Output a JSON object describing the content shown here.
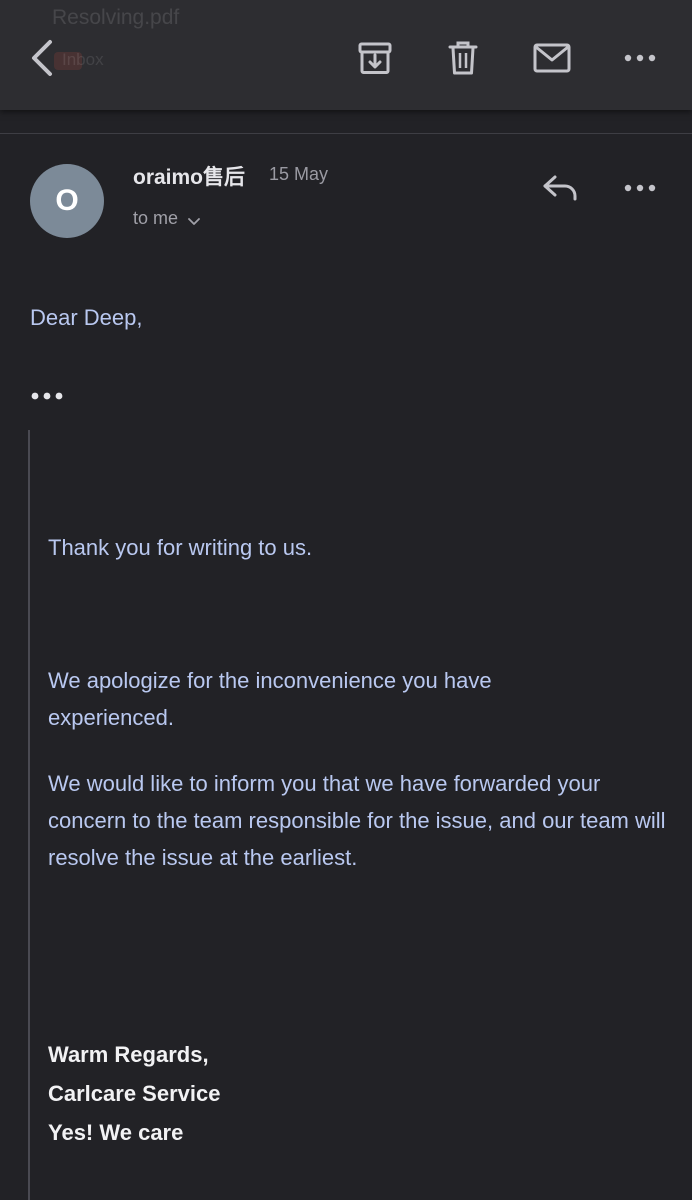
{
  "toolbar": {
    "ghost_title": "Resolving.pdf",
    "ghost_subtitle": "Inbox",
    "back_icon": "chevron-left-icon",
    "archive_icon": "archive-icon",
    "delete_icon": "trash-icon",
    "mark_unread_icon": "mail-icon",
    "more_icon": "more-horizontal-icon"
  },
  "message": {
    "avatar_letter": "O",
    "sender": "oraimo售后",
    "date": "15 May",
    "recipient_label": "to me",
    "greeting": "Dear Deep,",
    "paragraphs": [
      "Thank you for writing to us.",
      "We apologize for the inconvenience you have experienced.",
      "We would like to inform you that we have forwarded your concern to the team responsible for the issue, and our team will resolve the issue at the earliest."
    ],
    "signature": [
      "Warm Regards,",
      "Carlcare Service",
      "Yes! We care"
    ]
  },
  "colors": {
    "background": "#222226",
    "toolbar": "#2d2d31",
    "avatar": "#7c8a98",
    "body_text": "#b9c8f0",
    "icon": "#c4c4ca"
  }
}
